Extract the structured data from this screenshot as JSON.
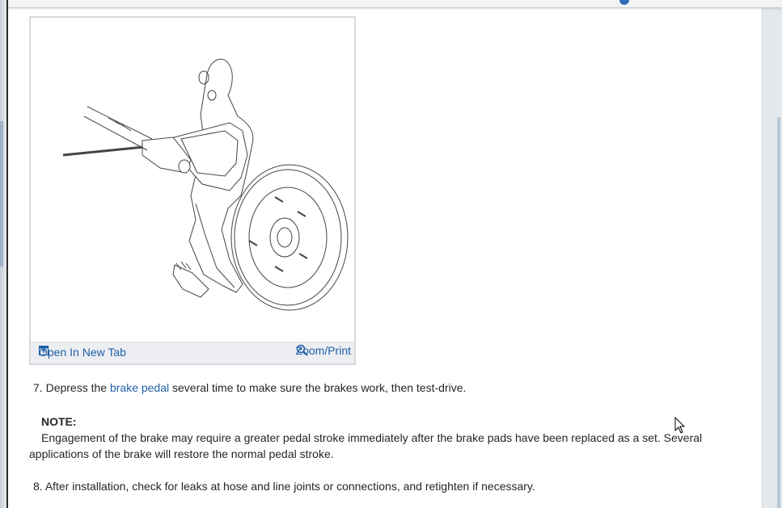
{
  "figure": {
    "open_tab_label": "Open In New Tab",
    "zoom_label": "Zoom/Print",
    "open_tab_icon": "open-in-new-tab-icon",
    "zoom_icon": "magnifier-plus-icon"
  },
  "steps": {
    "step7": {
      "number": "7.",
      "before": "Depress the",
      "link": "brake pedal",
      "after": "several time to make sure the brakes work, then test-drive."
    },
    "note": {
      "title": "NOTE:",
      "body": "Engagement of the brake may require a greater pedal stroke immediately after the brake pads have been replaced as a set. Several applications of the brake will restore the normal pedal stroke."
    },
    "step8": {
      "number": "8.",
      "text": "After installation, check for leaks at hose and line joints or connections, and retighten if necessary."
    }
  },
  "colors": {
    "link": "#1f5fa7",
    "figure_bar": "#eceef1"
  }
}
